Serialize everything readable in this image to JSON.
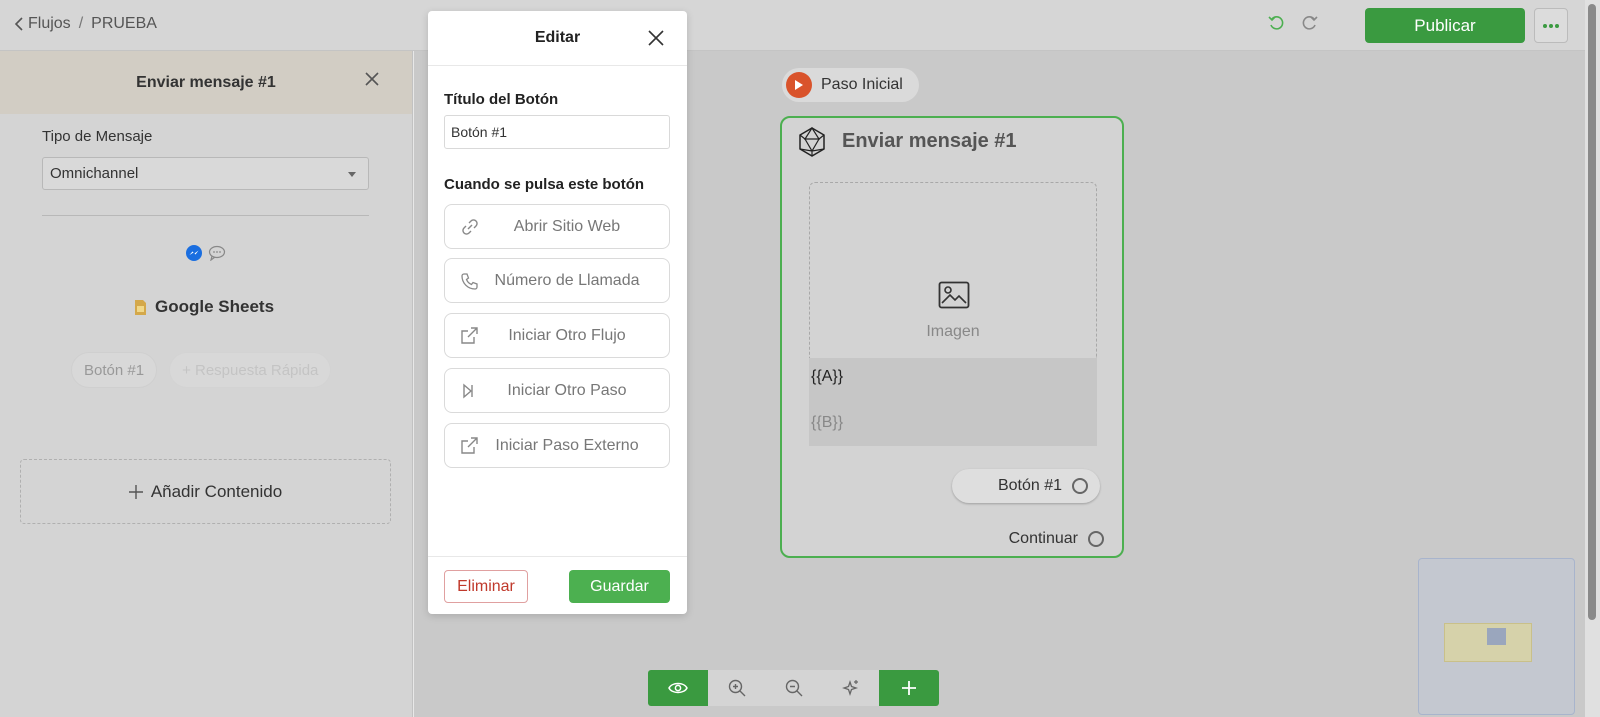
{
  "breadcrumb": {
    "back": "Flujos",
    "separator": "/",
    "current": "PRUEBA"
  },
  "toolbar": {
    "publish_label": "Publicar"
  },
  "left_panel": {
    "title": "Enviar mensaje #1",
    "message_type_label": "Tipo de Mensaje",
    "message_type_value": "Omnichannel",
    "integration_label": "Google Sheets",
    "chips": [
      "Botón #1",
      "+ Respuesta Rápida"
    ],
    "add_content_label": "Añadir Contenido"
  },
  "canvas": {
    "start_label": "Paso Inicial",
    "node": {
      "title": "Enviar mensaje #1",
      "image_label": "Imagen",
      "var_a": "{{A}}",
      "var_b": "{{B}}",
      "button_label": "Botón #1",
      "continue_label": "Continuar"
    }
  },
  "modal": {
    "title": "Editar",
    "button_title_label": "Título del Botón",
    "button_title_value": "Botón #1",
    "when_pressed_label": "Cuando se pulsa este botón",
    "actions": [
      {
        "label": "Abrir Sitio Web",
        "icon": "link-icon"
      },
      {
        "label": "Número de Llamada",
        "icon": "phone-icon"
      },
      {
        "label": "Iniciar Otro Flujo",
        "icon": "external-link-icon"
      },
      {
        "label": "Iniciar Otro Paso",
        "icon": "step-forward-icon"
      },
      {
        "label": "Iniciar Paso Externo",
        "icon": "external-link-icon"
      }
    ],
    "delete_label": "Eliminar",
    "save_label": "Guardar"
  },
  "colors": {
    "accent_green": "#3a9a40",
    "node_border": "#4caf50",
    "danger": "#c0392b",
    "start_dot": "#d9532b"
  }
}
